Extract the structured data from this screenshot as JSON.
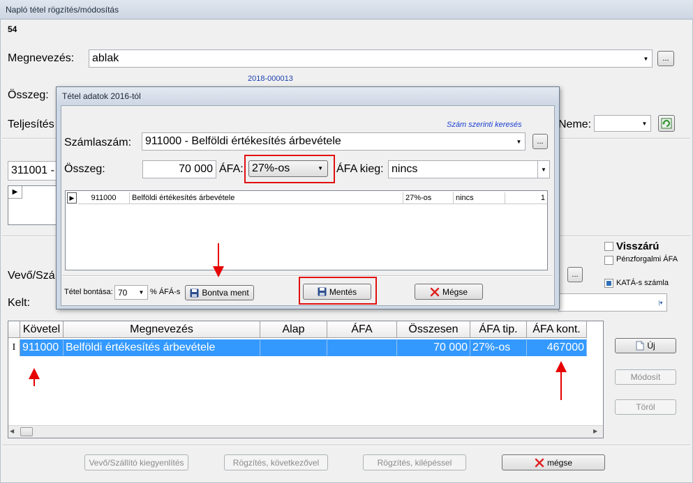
{
  "window": {
    "title": "Napló tétel rögzítés/módosítás",
    "record_no": "54"
  },
  "form": {
    "megnevezes_label": "Megnevezés:",
    "megnevezes_value": "ablak",
    "ellipsis": "...",
    "doc_number": "2018-000013",
    "osszeg_label": "Összeg:",
    "teljesites_label": "Teljesítés",
    "neme_label": "Neme:",
    "account_value": "311001 -",
    "vevo_label": "Vevő/Szá",
    "kelt_label": "Kelt:",
    "visszaru_label": "Visszárú",
    "penzforgalmi_label": "Pénzforgalmi ÁFA",
    "kata_label": "KATÁ-s számla"
  },
  "grid": {
    "headers": [
      "Követel",
      "Megnevezés",
      "Alap",
      "ÁFA",
      "Összesen",
      "ÁFA tip.",
      "ÁFA kont."
    ],
    "row_marker": "I",
    "row": {
      "kovetel": "911000",
      "megnevezes": "Belföldi értékesítés árbevétele",
      "alap": "",
      "afa": "",
      "osszesen": "70 000",
      "afa_tip": "27%-os",
      "afa_kont": "467000"
    }
  },
  "side_buttons": {
    "new": "Új",
    "modify": "Módosít",
    "delete": "Töröl"
  },
  "bottom_buttons": {
    "vevo": "Vevő/Szállító kiegyenlítés",
    "rogzites_kov": "Rögzítés, következővel",
    "rogzites_kilep": "Rögzítés, kilépéssel",
    "megse": "mégse"
  },
  "dialog": {
    "title": "Tétel adatok 2016-tól",
    "search_link": "Szám szerinti keresés",
    "szamlaszam_label": "Számlaszám:",
    "szamlaszam_value": "911000 - Belföldi értékesítés árbevétele",
    "osszeg_label": "Összeg:",
    "osszeg_value": "70 000",
    "afa_label": "ÁFA:",
    "afa_value": "27%-os",
    "afa_kieg_label": "ÁFA kieg:",
    "afa_kieg_value": "nincs",
    "list_row": [
      "911000",
      "Belföldi értékesítés árbevétele",
      "27%-os",
      "nincs",
      "1"
    ],
    "bontasa_label": "Tétel bontása:",
    "bontasa_value": "70",
    "afas_label": "% ÁFÁ-s",
    "bontva_ment": "Bontva ment",
    "mentes": "Mentés",
    "megse": "Mégse"
  },
  "colors": {
    "selection": "#3399ff",
    "highlight_red": "#e01010"
  }
}
